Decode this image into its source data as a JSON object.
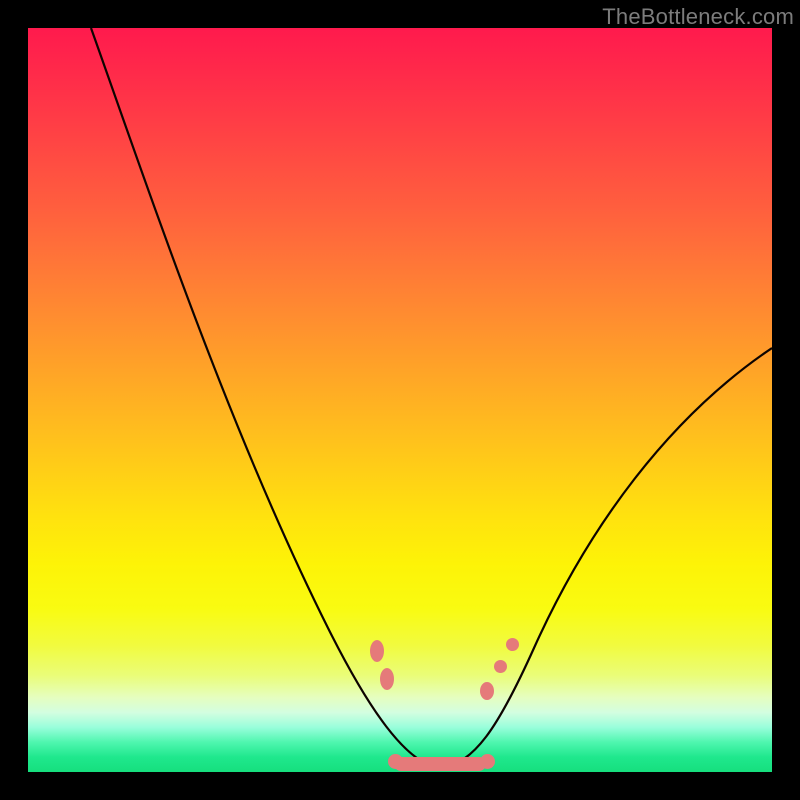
{
  "watermark": "TheBottleneck.com",
  "colors": {
    "curve": "#0d0400",
    "marker": "#e57a7a",
    "frame": "#000000"
  },
  "chart_data": {
    "type": "line",
    "title": "",
    "xlabel": "",
    "ylabel": "",
    "xlim": [
      0,
      100
    ],
    "ylim": [
      0,
      100
    ],
    "grid": false,
    "series": [
      {
        "name": "bottleneck-curve",
        "x": [
          10,
          14,
          18,
          22,
          26,
          30,
          34,
          38,
          42,
          44,
          46,
          48,
          50,
          52,
          54,
          56,
          58,
          60,
          62,
          66,
          70,
          74,
          78,
          82,
          86,
          90,
          94,
          98
        ],
        "values": [
          100,
          90,
          80,
          70,
          60,
          51,
          42,
          33,
          24,
          20,
          15,
          10,
          6,
          3,
          1,
          0,
          0,
          1,
          3,
          8,
          14,
          20,
          27,
          34,
          40,
          46,
          52,
          57
        ]
      }
    ],
    "annotations": {
      "left_cluster": {
        "x": 48,
        "y": 10
      },
      "right_cluster": {
        "x": 62,
        "y": 8
      },
      "bottom_band": {
        "x_start": 50,
        "x_end": 60,
        "y": 0
      }
    }
  }
}
